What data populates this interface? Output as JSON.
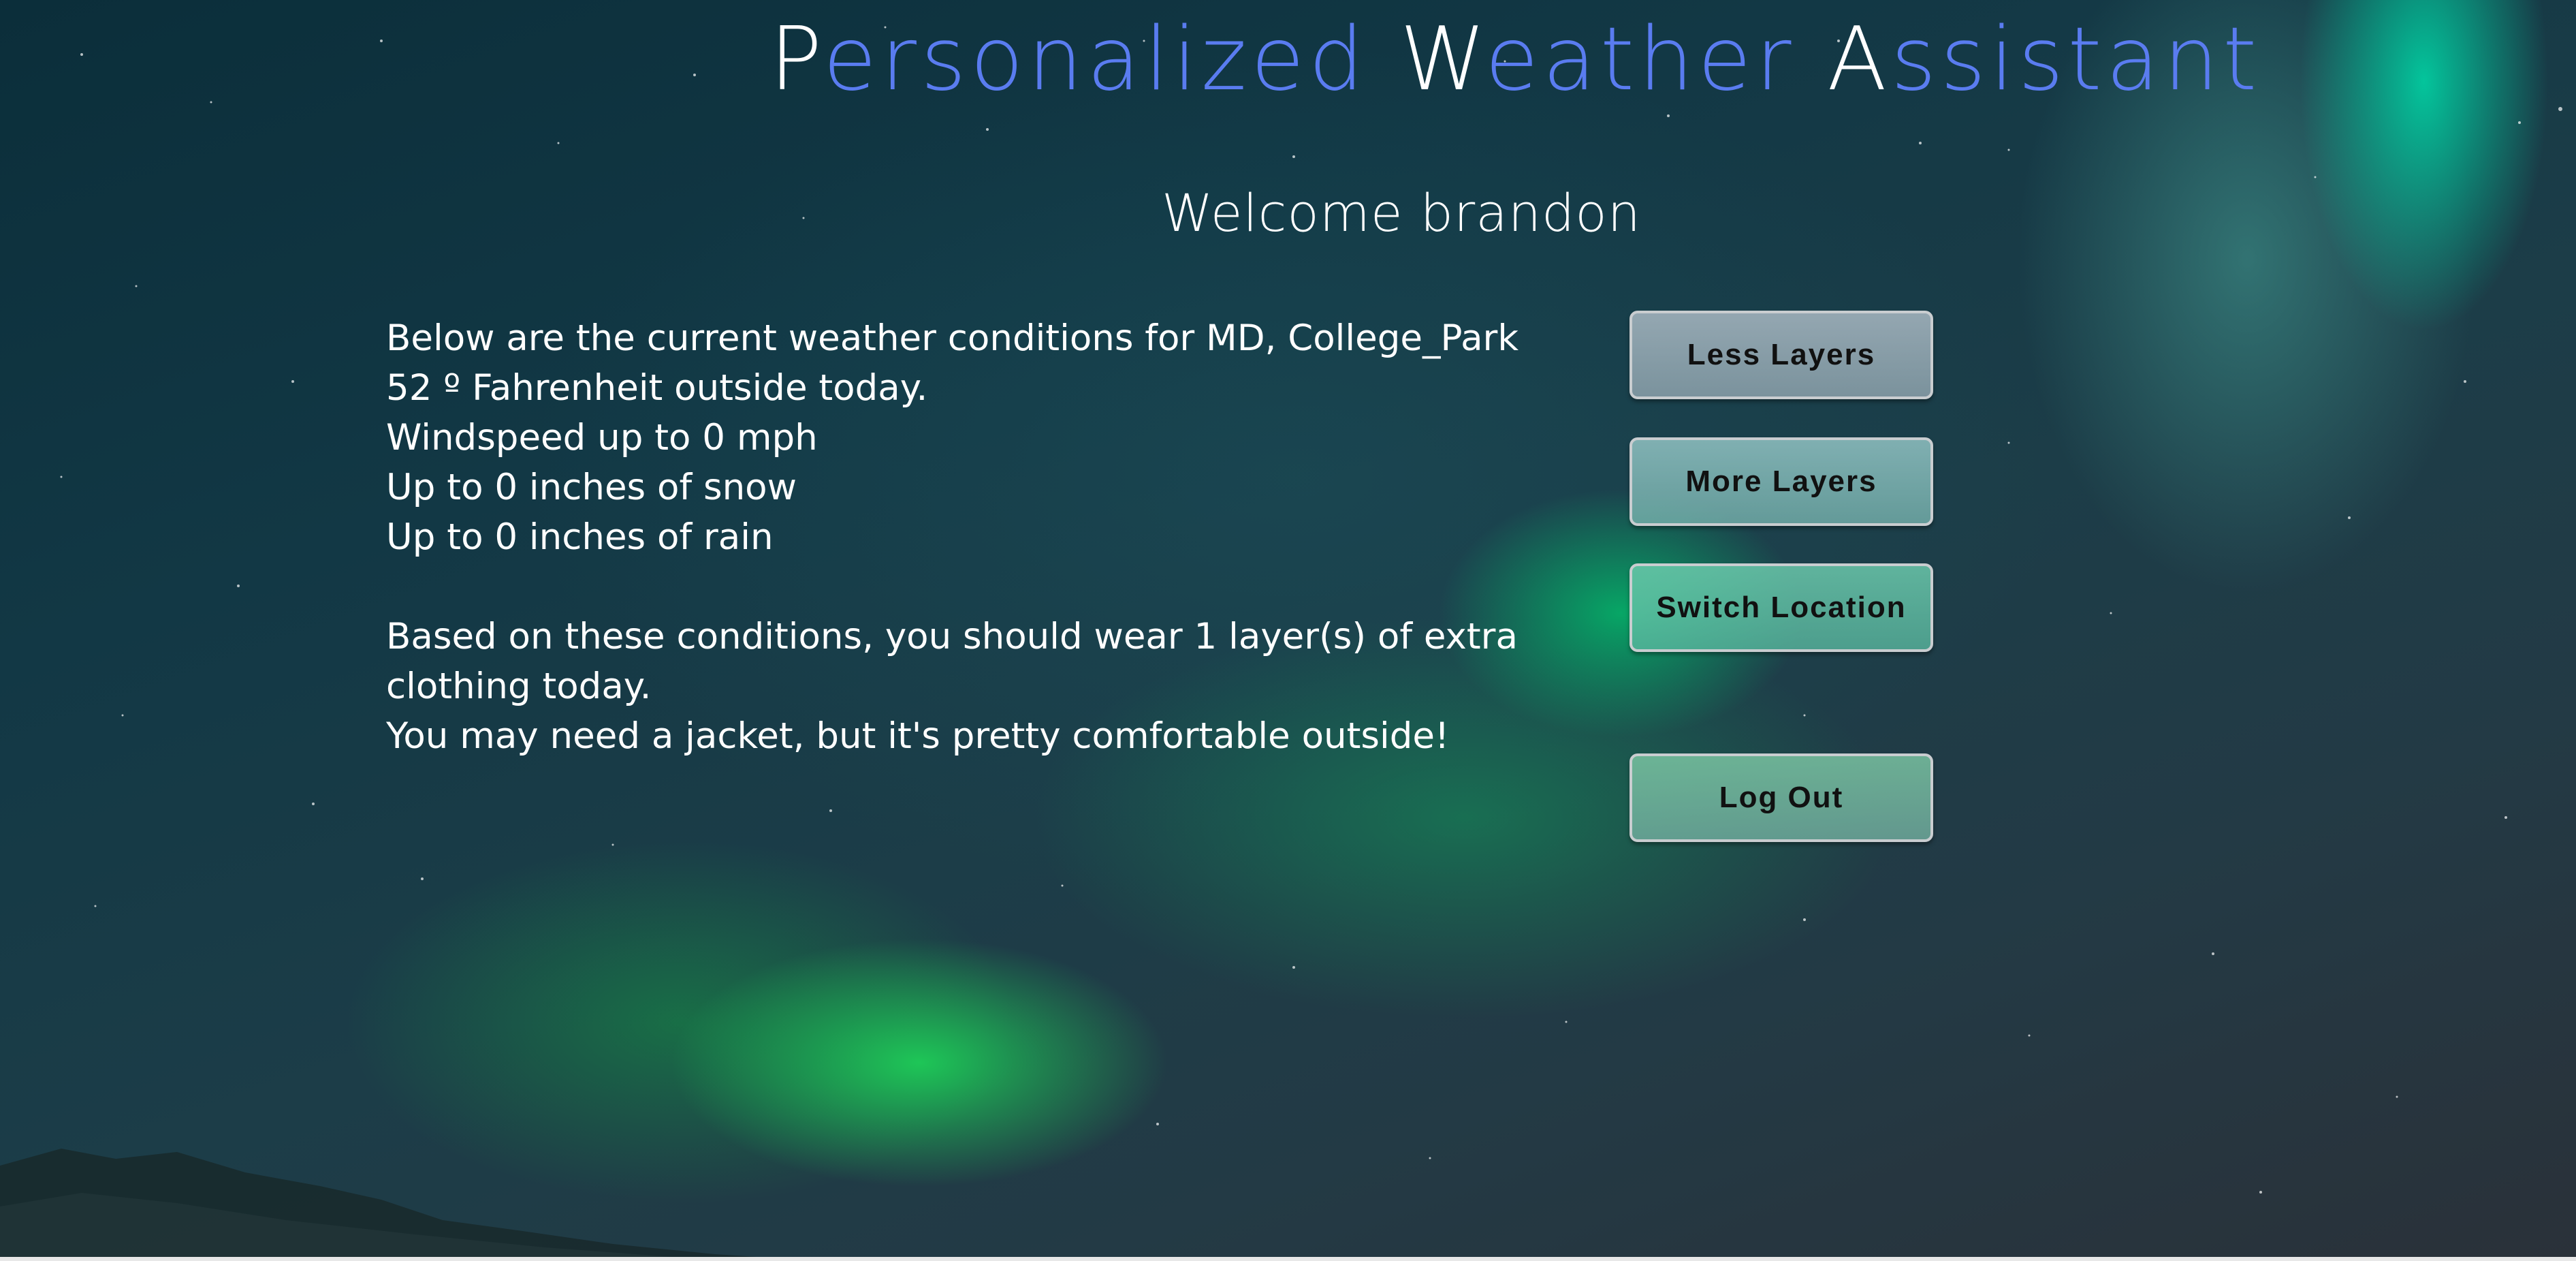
{
  "header": {
    "title_words": [
      {
        "cap": "P",
        "rest": "ersonalized"
      },
      {
        "cap": "W",
        "rest": "eather"
      },
      {
        "cap": "A",
        "rest": "ssistant"
      }
    ],
    "welcome": "Welcome brandon"
  },
  "conditions": {
    "intro": "Below are the current weather conditions for MD, College_Park",
    "temperature": "52 º Fahrenheit outside today.",
    "wind": "Windspeed up to 0 mph",
    "snow": "Up to 0 inches of snow",
    "rain": "Up to 0 inches of rain",
    "recommendation": "Based on these conditions, you should wear 1 layer(s) of extra clothing today.",
    "advice": "You may need a jacket, but it's pretty comfortable outside!"
  },
  "actions": {
    "less_layers": "Less Layers",
    "more_layers": "More Layers",
    "switch_location": "Switch Location",
    "log_out": "Log Out"
  },
  "colors": {
    "title_accent": "#5a7cf0",
    "title_caps": "#ffffff",
    "button_text": "#111111"
  }
}
